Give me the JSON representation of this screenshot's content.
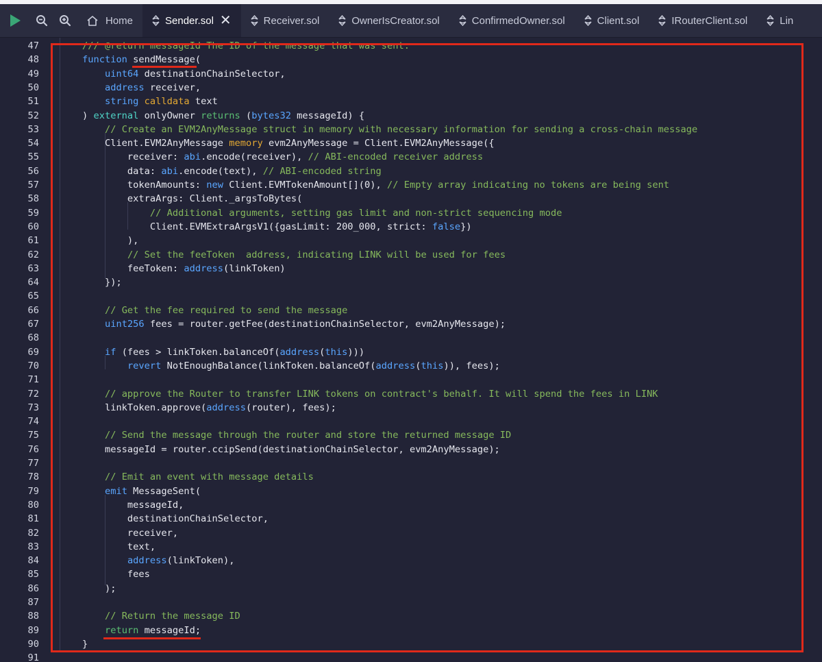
{
  "toolbar": {
    "run_icon": "play-icon",
    "zoom_out_icon": "zoom-out-icon",
    "zoom_in_icon": "zoom-in-icon"
  },
  "tabs": [
    {
      "label": "Home",
      "icon": "home-icon",
      "active": false
    },
    {
      "label": "Sender.sol",
      "icon": "solidity-file-icon",
      "active": true,
      "closable": true
    },
    {
      "label": "Receiver.sol",
      "icon": "solidity-file-icon",
      "active": false
    },
    {
      "label": "OwnerIsCreator.sol",
      "icon": "solidity-file-icon",
      "active": false
    },
    {
      "label": "ConfirmedOwner.sol",
      "icon": "solidity-file-icon",
      "active": false
    },
    {
      "label": "Client.sol",
      "icon": "solidity-file-icon",
      "active": false
    },
    {
      "label": "IRouterClient.sol",
      "icon": "solidity-file-icon",
      "active": false
    },
    {
      "label": "Lin",
      "icon": "solidity-file-icon",
      "active": false
    }
  ],
  "editor": {
    "colors": {
      "highlight_box": "#e0291a",
      "background": "#222336"
    },
    "lines": [
      {
        "n": "47",
        "t": "/// @return messageId The ID of the message that was sent."
      },
      {
        "n": "48",
        "t": "function sendMessage("
      },
      {
        "n": "49",
        "t": "    uint64 destinationChainSelector,"
      },
      {
        "n": "50",
        "t": "    address receiver,"
      },
      {
        "n": "51",
        "t": "    string calldata text"
      },
      {
        "n": "52",
        "t": ") external onlyOwner returns (bytes32 messageId) {"
      },
      {
        "n": "53",
        "t": "    // Create an EVM2AnyMessage struct in memory with necessary information for sending a cross-chain message"
      },
      {
        "n": "54",
        "t": "    Client.EVM2AnyMessage memory evm2AnyMessage = Client.EVM2AnyMessage({"
      },
      {
        "n": "55",
        "t": "        receiver: abi.encode(receiver), // ABI-encoded receiver address"
      },
      {
        "n": "56",
        "t": "        data: abi.encode(text), // ABI-encoded string"
      },
      {
        "n": "57",
        "t": "        tokenAmounts: new Client.EVMTokenAmount[](0), // Empty array indicating no tokens are being sent"
      },
      {
        "n": "58",
        "t": "        extraArgs: Client._argsToBytes("
      },
      {
        "n": "59",
        "t": "            // Additional arguments, setting gas limit and non-strict sequencing mode"
      },
      {
        "n": "60",
        "t": "            Client.EVMExtraArgsV1({gasLimit: 200_000, strict: false})"
      },
      {
        "n": "61",
        "t": "        ),"
      },
      {
        "n": "62",
        "t": "        // Set the feeToken  address, indicating LINK will be used for fees"
      },
      {
        "n": "63",
        "t": "        feeToken: address(linkToken)"
      },
      {
        "n": "64",
        "t": "    });"
      },
      {
        "n": "65",
        "t": ""
      },
      {
        "n": "66",
        "t": "    // Get the fee required to send the message"
      },
      {
        "n": "67",
        "t": "    uint256 fees = router.getFee(destinationChainSelector, evm2AnyMessage);"
      },
      {
        "n": "68",
        "t": ""
      },
      {
        "n": "69",
        "t": "    if (fees > linkToken.balanceOf(address(this)))"
      },
      {
        "n": "70",
        "t": "        revert NotEnoughBalance(linkToken.balanceOf(address(this)), fees);"
      },
      {
        "n": "71",
        "t": ""
      },
      {
        "n": "72",
        "t": "    // approve the Router to transfer LINK tokens on contract's behalf. It will spend the fees in LINK"
      },
      {
        "n": "73",
        "t": "    linkToken.approve(address(router), fees);"
      },
      {
        "n": "74",
        "t": ""
      },
      {
        "n": "75",
        "t": "    // Send the message through the router and store the returned message ID"
      },
      {
        "n": "76",
        "t": "    messageId = router.ccipSend(destinationChainSelector, evm2AnyMessage);"
      },
      {
        "n": "77",
        "t": ""
      },
      {
        "n": "78",
        "t": "    // Emit an event with message details"
      },
      {
        "n": "79",
        "t": "    emit MessageSent("
      },
      {
        "n": "80",
        "t": "        messageId,"
      },
      {
        "n": "81",
        "t": "        destinationChainSelector,"
      },
      {
        "n": "82",
        "t": "        receiver,"
      },
      {
        "n": "83",
        "t": "        text,"
      },
      {
        "n": "84",
        "t": "        address(linkToken),"
      },
      {
        "n": "85",
        "t": "        fees"
      },
      {
        "n": "86",
        "t": "    );"
      },
      {
        "n": "87",
        "t": ""
      },
      {
        "n": "88",
        "t": "    // Return the message ID"
      },
      {
        "n": "89",
        "t": "    return messageId;"
      },
      {
        "n": "90",
        "t": "}"
      },
      {
        "n": "91",
        "t": ""
      }
    ]
  }
}
